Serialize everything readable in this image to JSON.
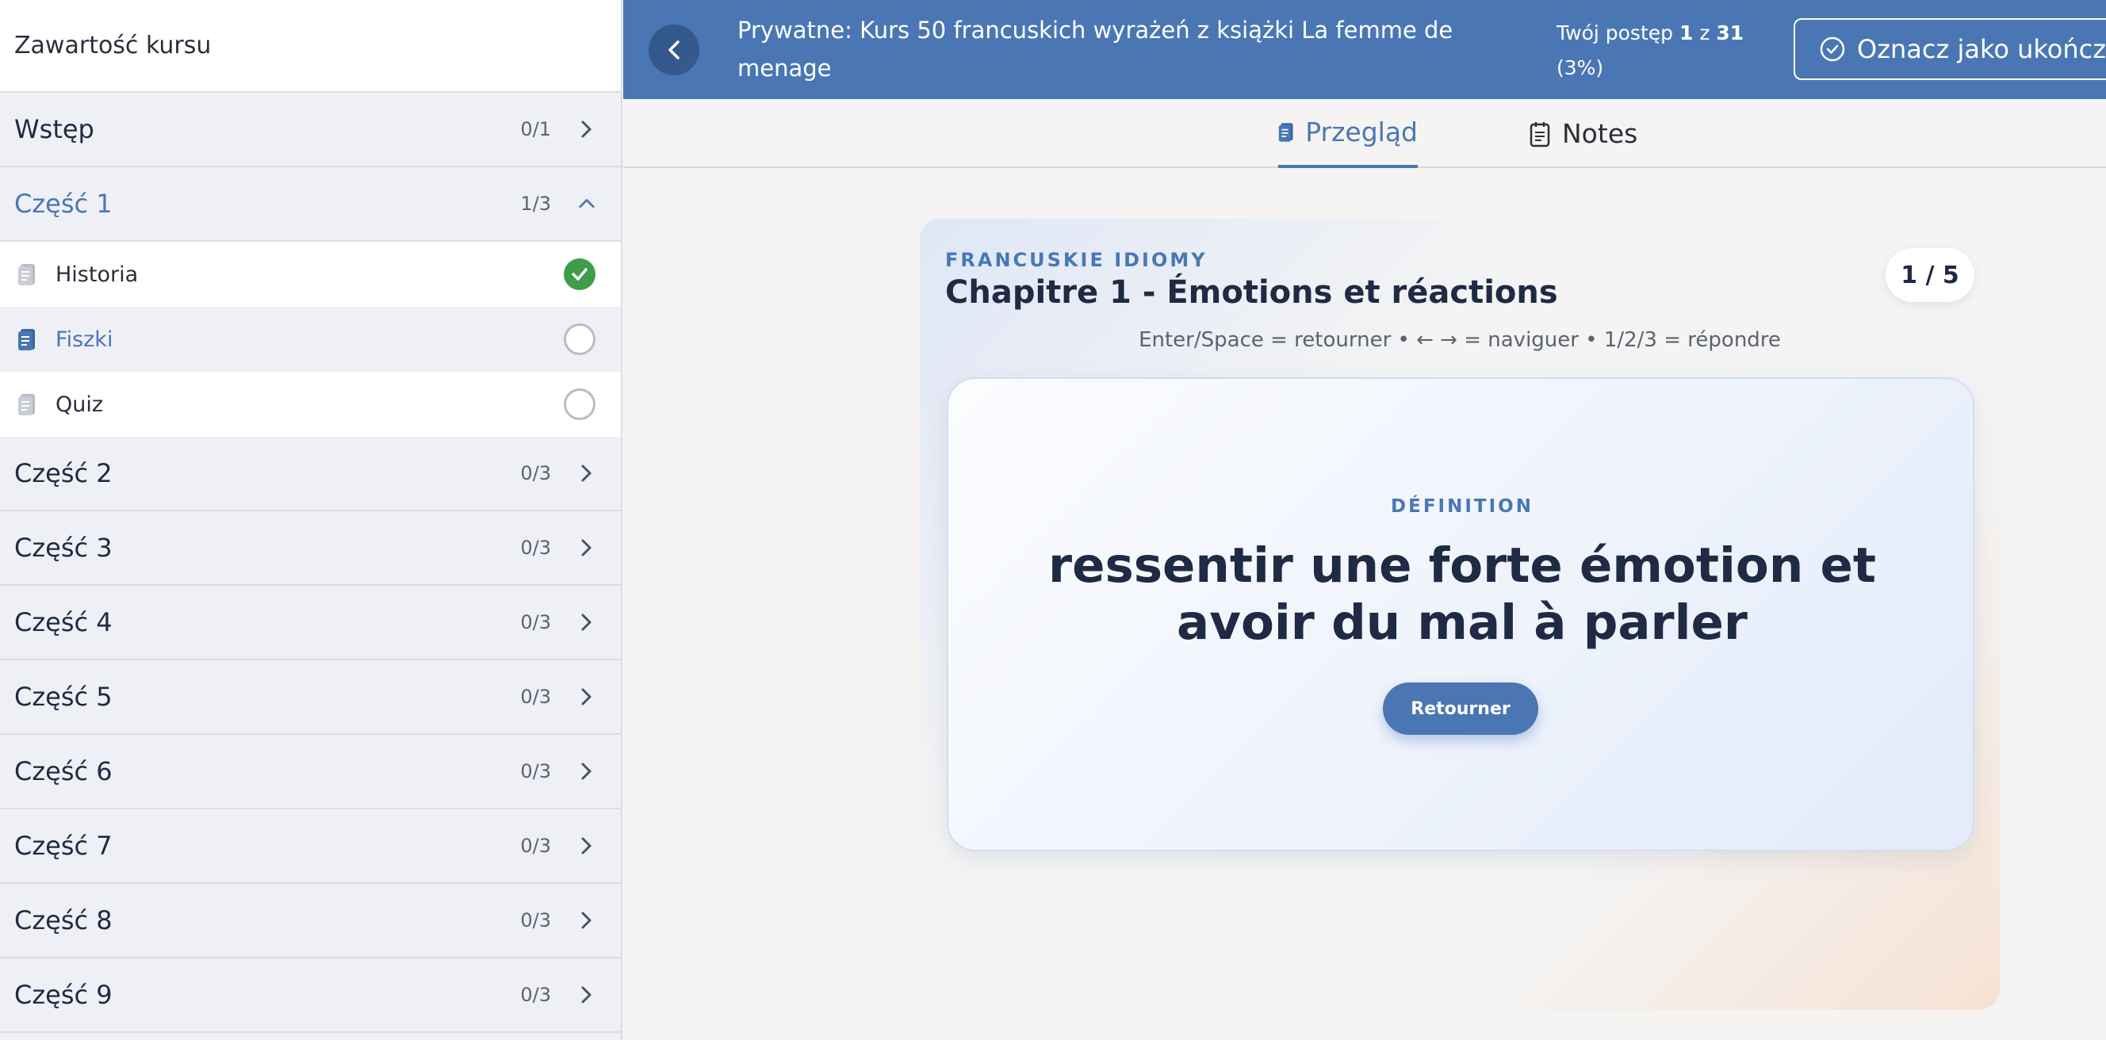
{
  "sidebar": {
    "header": "Zawartość kursu",
    "sections": [
      {
        "title": "Wstęp",
        "count": "0/1"
      },
      {
        "title": "Część 1",
        "count": "1/3",
        "expanded": true
      },
      {
        "title": "Część 2",
        "count": "0/3"
      },
      {
        "title": "Część 3",
        "count": "0/3"
      },
      {
        "title": "Część 4",
        "count": "0/3"
      },
      {
        "title": "Część 5",
        "count": "0/3"
      },
      {
        "title": "Część 6",
        "count": "0/3"
      },
      {
        "title": "Część 7",
        "count": "0/3"
      },
      {
        "title": "Część 8",
        "count": "0/3"
      },
      {
        "title": "Część 9",
        "count": "0/3"
      }
    ],
    "lessons": [
      {
        "title": "Historia",
        "done": true
      },
      {
        "title": "Fiszki",
        "done": false,
        "current": true
      },
      {
        "title": "Quiz",
        "done": false
      }
    ]
  },
  "topbar": {
    "course_title": "Prywatne: Kurs 50 francuskich wyrażeń z książki La femme de menage",
    "progress_prefix": "Twój postęp",
    "progress_current": "1",
    "progress_sep": "z",
    "progress_total": "31",
    "progress_percent": "(3%)",
    "complete_label": "Oznacz jako ukończone"
  },
  "tabs": {
    "review": "Przegląd",
    "notes": "Notes"
  },
  "card": {
    "eyebrow": "FRANCUSKIE IDIOMY",
    "chapter": "Chapitre 1 - Émotions et réactions",
    "counter": "1 / 5",
    "shortcuts": "Enter/Space = retourner • ← → = naviguer • 1/2/3 = répondre",
    "label": "DÉFINITION",
    "text": "ressentir une forte émotion et avoir du mal à parler",
    "flip_label": "Retourner"
  },
  "colors": {
    "brand": "#4a77b4",
    "success": "#3e9c4b",
    "text_dark": "#1f2a44"
  },
  "icons": {
    "back": "chevron-left-icon",
    "complete": "check-circle-icon",
    "review": "document-icon",
    "notes": "notepad-icon",
    "section_collapsed": "chevron-right-icon",
    "section_expanded": "chevron-up-icon",
    "lesson": "document-icon"
  }
}
